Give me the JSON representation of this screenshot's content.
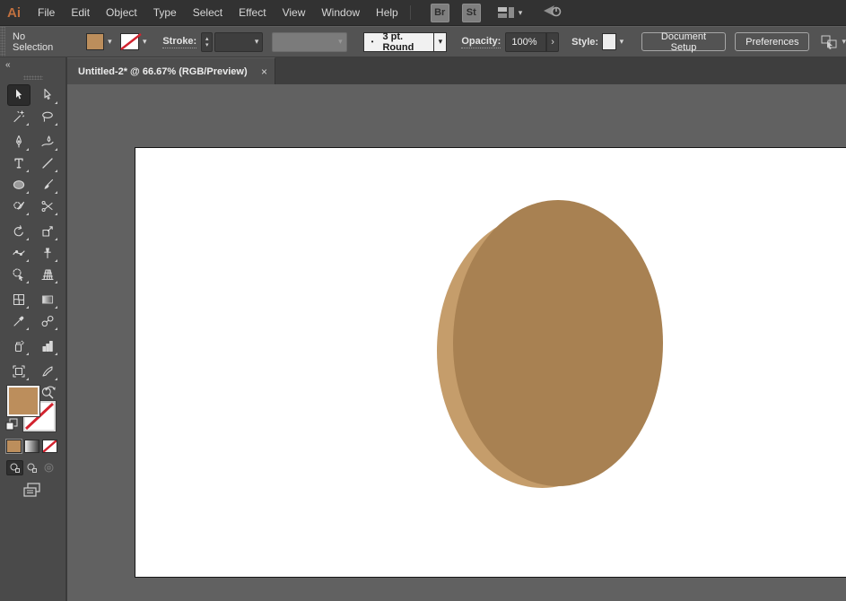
{
  "app": {
    "logo": "Ai"
  },
  "menubar": {
    "items": [
      "File",
      "Edit",
      "Object",
      "Type",
      "Select",
      "Effect",
      "View",
      "Window",
      "Help"
    ],
    "bridge_label": "Br",
    "stock_label": "St"
  },
  "control_bar": {
    "selection_status": "No Selection",
    "stroke_label": "Stroke:",
    "brush_bullet": "•",
    "brush_value": "3 pt. Round",
    "opacity_label": "Opacity:",
    "opacity_value": "100%",
    "style_label": "Style:",
    "document_setup_label": "Document Setup",
    "preferences_label": "Preferences"
  },
  "tab": {
    "title": "Untitled-2* @ 66.67% (RGB/Preview)"
  },
  "icons": {
    "collapse": "«",
    "close": "×",
    "chevron_down": "▾",
    "chevron_up": "▴",
    "arrow_right": "›"
  },
  "colors": {
    "fill_swatch": "#bc8e5c",
    "ellipse_front": "#a88152",
    "ellipse_back": "#c59d6b",
    "none_red": "#d2232f",
    "canvas_bg": "#616161"
  }
}
